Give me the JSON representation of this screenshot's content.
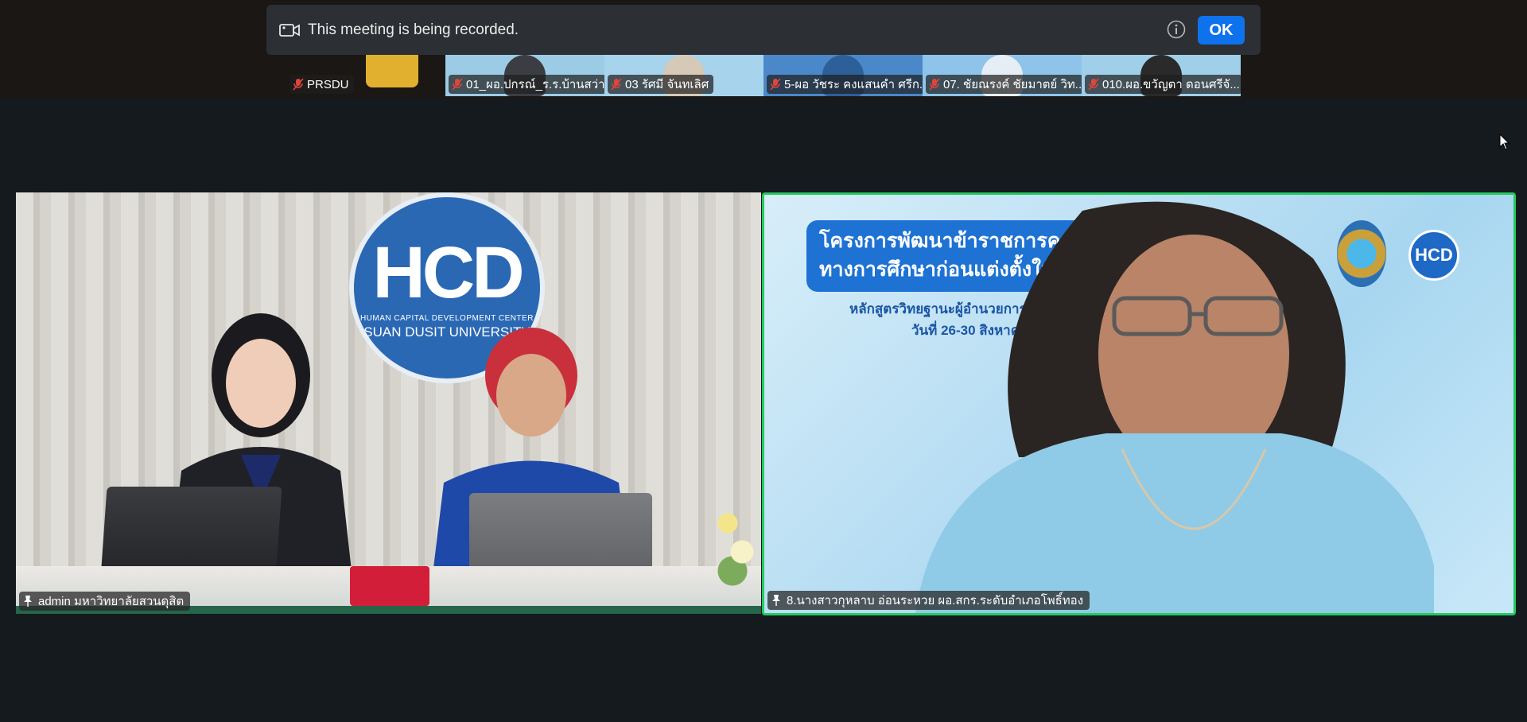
{
  "recording_banner": {
    "text": "This meeting is being recorded.",
    "ok_label": "OK"
  },
  "thumbnails": [
    {
      "name": "PRSDU",
      "bg": "#1a1714",
      "person": "#e0b02e"
    },
    {
      "name": "01_ผอ.ปกรณ์_ร.ร.บ้านสว่า",
      "bg": "#9ccbe6",
      "person": "#3b3d42"
    },
    {
      "name": "03 รัศมี จันทเลิศ",
      "bg": "#a7d3ed",
      "person": "#d6c9b8"
    },
    {
      "name": "5-ผอ วัชระ คงแสนคำ ศรีก...",
      "bg": "#4a88c9",
      "person": "#2d5f99"
    },
    {
      "name": "07. ชัยณรงค์ ชัยมาตย์ วิท...",
      "bg": "#8ec4ea",
      "person": "#e6eef5"
    },
    {
      "name": "010.ผอ.ขวัญตา ดอนศรีจั...",
      "bg": "#a0cfe9",
      "person": "#2a2a2a"
    }
  ],
  "tiles": {
    "left_name": "admin มหาวิทยาลัยสวนดุสิต",
    "right_name": "8.นางสาวกุหลาบ อ่อนระหวย ผอ.สกร.ระดับอำเภอโพธิ์ทอง"
  },
  "left_scene": {
    "logo_mark": "HCD",
    "logo_sub": "HUMAN CAPITAL DEVELOPMENT CENTER",
    "logo_uni": "SUAN DUSIT UNIVERSITY"
  },
  "right_scene": {
    "slide_line1": "โครงการพัฒนาข้าราชการค",
    "slide_line2": "ทางการศึกษาก่อนแต่งตั้งให้มีแ",
    "slide_sub1": "หลักสูตรวิทยฐานะผู้อำนวยการและรอ",
    "slide_sub2": "วันที่ 26-30 สิงหาคม 2568",
    "small_logo": "HCD"
  },
  "colors": {
    "accent_green": "#25c95f",
    "ok_blue": "#0e72ed",
    "muted_red": "#e0453c"
  },
  "icons": [
    "record-icon",
    "info-icon",
    "mic-muted-icon",
    "pin-icon",
    "cursor-icon"
  ]
}
